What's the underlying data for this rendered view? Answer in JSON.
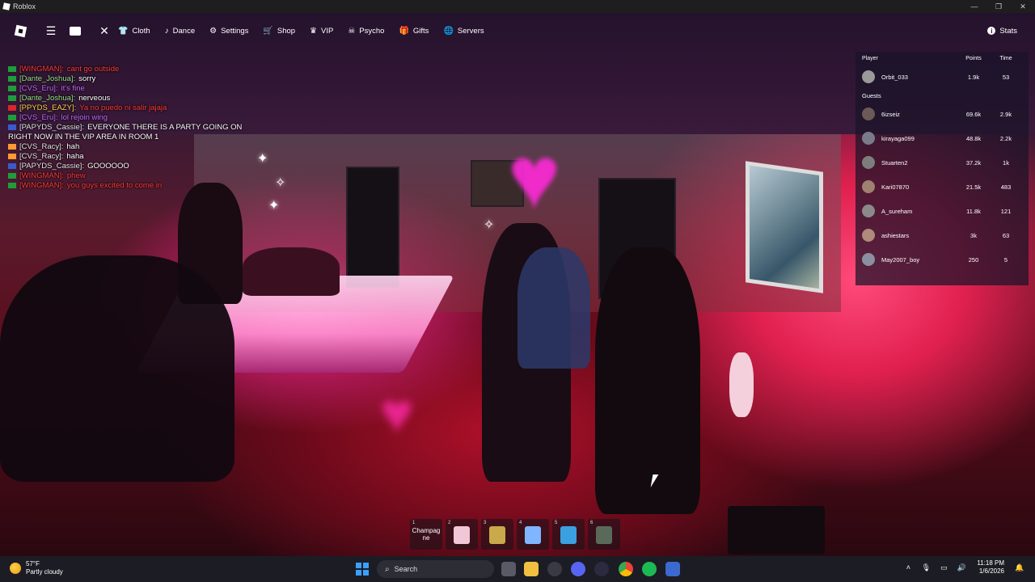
{
  "window": {
    "title": "Roblox",
    "controls": [
      "—",
      "❐",
      "✕"
    ]
  },
  "topbar": {
    "menu": [
      {
        "label": "Cloth",
        "icon": "shirt-icon",
        "glyph": "👕"
      },
      {
        "label": "Dance",
        "icon": "music-note-icon",
        "glyph": "♪"
      },
      {
        "label": "Settings",
        "icon": "gear-icon",
        "glyph": "⚙"
      },
      {
        "label": "Shop",
        "icon": "cart-icon",
        "glyph": "🛒"
      },
      {
        "label": "VIP",
        "icon": "crown-icon",
        "glyph": "♛"
      },
      {
        "label": "Psycho",
        "icon": "skull-icon",
        "glyph": "☠"
      },
      {
        "label": "Gifts",
        "icon": "gift-icon",
        "glyph": "🎁"
      },
      {
        "label": "Servers",
        "icon": "globe-icon",
        "glyph": "🌐"
      }
    ],
    "stats_label": "Stats"
  },
  "chat": [
    {
      "name": "[WINGMAN]:",
      "msg": "cant go outside",
      "name_color": "#ff3b3b",
      "msg_color": "#ff3b3b",
      "flag": "#1f9d3a"
    },
    {
      "name": "[Dante_Joshua]:",
      "msg": "sorry",
      "name_color": "#9ae38a",
      "msg_color": "#ffffff",
      "flag": "#1f9d3a"
    },
    {
      "name": "[CVS_Eru]:",
      "msg": "it's fine",
      "name_color": "#c56bff",
      "msg_color": "#c56bff",
      "flag": "#1f9d3a"
    },
    {
      "name": "[Dante_Joshua]:",
      "msg": "nerveous",
      "name_color": "#9ae38a",
      "msg_color": "#ffffff",
      "flag": "#1f9d3a"
    },
    {
      "name": "[PPYDS_EAZY]:",
      "msg": "Ya no puedo ni salir jajaja",
      "name_color": "#ffd34a",
      "msg_color": "#ff3b3b",
      "flag": "#d9262b"
    },
    {
      "name": "[CVS_Eru]:",
      "msg": "lol rejoin wing",
      "name_color": "#c56bff",
      "msg_color": "#c56bff",
      "flag": "#1f9d3a"
    },
    {
      "name": "[PAPYDS_Cassie]:",
      "msg": "EVERYONE THERE IS A PARTY GOING ON RIGHT NOW IN THE VIP AREA IN ROOM 1",
      "name_color": "#e6e6e6",
      "msg_color": "#ffffff",
      "flag": "#3a5bd0"
    },
    {
      "name": "[CVS_Racy]:",
      "msg": "hah",
      "name_color": "#e6e6e6",
      "msg_color": "#ffffff",
      "flag": "#ff9933"
    },
    {
      "name": "[CVS_Racy]:",
      "msg": "haha",
      "name_color": "#e6e6e6",
      "msg_color": "#ffffff",
      "flag": "#ff9933"
    },
    {
      "name": "[PAPYDS_Cassie]:",
      "msg": "GOOOOOO",
      "name_color": "#e6e6e6",
      "msg_color": "#ffffff",
      "flag": "#3a5bd0"
    },
    {
      "name": "[WINGMAN]:",
      "msg": "phew",
      "name_color": "#ff3b3b",
      "msg_color": "#ff3b3b",
      "flag": "#1f9d3a"
    },
    {
      "name": "[WINGMAN]:",
      "msg": "you guys excited to come in",
      "name_color": "#ff3b3b",
      "msg_color": "#ff3b3b",
      "flag": "#1f9d3a"
    }
  ],
  "leaderboard": {
    "headers": {
      "player": "Player",
      "points": "Points",
      "time": "Time"
    },
    "top_rows": [
      {
        "name": "Orbit_033",
        "points": "1.9k",
        "time": "53",
        "avatar": "#9a9a9a"
      }
    ],
    "guests_label": "Guests",
    "guests": [
      {
        "name": "6izseiz",
        "points": "69.6k",
        "time": "2.9k",
        "avatar": "#6b5a55"
      },
      {
        "name": "kirayaga099",
        "points": "48.8k",
        "time": "2.2k",
        "avatar": "#7a7a8a"
      },
      {
        "name": "Stuarten2",
        "points": "37.2k",
        "time": "1k",
        "avatar": "#7d7d7d"
      },
      {
        "name": "Kari07870",
        "points": "21.5k",
        "time": "483",
        "avatar": "#a08070"
      },
      {
        "name": "A_sureham",
        "points": "11.8k",
        "time": "121",
        "avatar": "#8a8a8a"
      },
      {
        "name": "ashiestars",
        "points": "3k",
        "time": "63",
        "avatar": "#b08a7a"
      },
      {
        "name": "May2007_boy",
        "points": "250",
        "time": "5",
        "avatar": "#8a90a0"
      }
    ]
  },
  "hotbar": [
    {
      "num": "1",
      "label": "Champag ne",
      "color": ""
    },
    {
      "num": "2",
      "label": "",
      "color": "#f1c6d6"
    },
    {
      "num": "3",
      "label": "",
      "color": "#c9a94a"
    },
    {
      "num": "4",
      "label": "",
      "color": "#7fb6ff"
    },
    {
      "num": "5",
      "label": "",
      "color": "#3aa0e0"
    },
    {
      "num": "6",
      "label": "",
      "color": "#5a6a5a"
    }
  ],
  "taskbar": {
    "weather_temp": "57°F",
    "weather_desc": "Partly cloudy",
    "search_placeholder": "Search",
    "time": "11:18 PM",
    "date": "1/6/2026"
  }
}
